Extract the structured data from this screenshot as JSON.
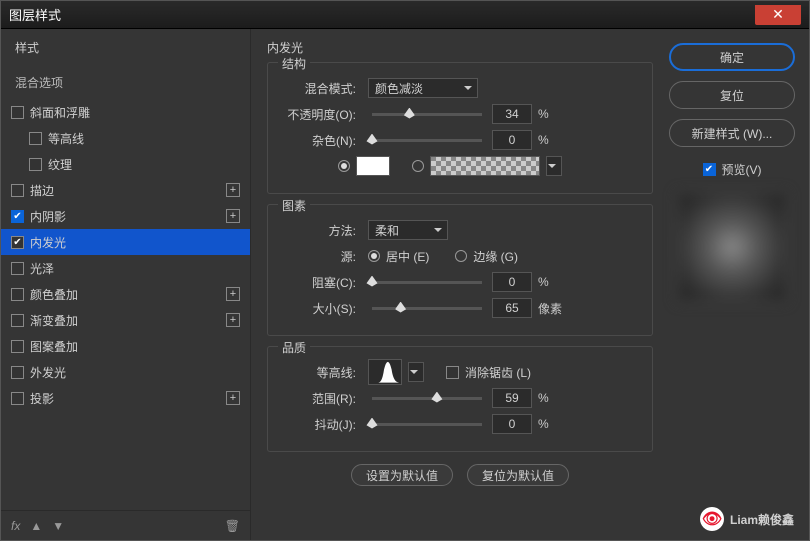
{
  "window": {
    "title": "图层样式"
  },
  "sidebar": {
    "styles_label": "样式",
    "blending_label": "混合选项",
    "items": [
      {
        "label": "斜面和浮雕",
        "checked": false,
        "hasFx": false,
        "indent": false
      },
      {
        "label": "等高线",
        "checked": false,
        "hasFx": false,
        "indent": true
      },
      {
        "label": "纹理",
        "checked": false,
        "hasFx": false,
        "indent": true
      },
      {
        "label": "描边",
        "checked": false,
        "hasFx": true,
        "indent": false
      },
      {
        "label": "内阴影",
        "checked": true,
        "hasFx": true,
        "indent": false
      },
      {
        "label": "内发光",
        "checked": true,
        "hasFx": false,
        "indent": false,
        "selected": true
      },
      {
        "label": "光泽",
        "checked": false,
        "hasFx": false,
        "indent": false
      },
      {
        "label": "颜色叠加",
        "checked": false,
        "hasFx": true,
        "indent": false
      },
      {
        "label": "渐变叠加",
        "checked": false,
        "hasFx": true,
        "indent": false
      },
      {
        "label": "图案叠加",
        "checked": false,
        "hasFx": false,
        "indent": false
      },
      {
        "label": "外发光",
        "checked": false,
        "hasFx": false,
        "indent": false
      },
      {
        "label": "投影",
        "checked": false,
        "hasFx": true,
        "indent": false
      }
    ],
    "fx_label": "fx"
  },
  "panel": {
    "title": "内发光",
    "structure": {
      "group_label": "结构",
      "blend_mode_label": "混合模式:",
      "blend_mode_value": "颜色减淡",
      "opacity_label": "不透明度(O):",
      "opacity_value": "34",
      "opacity_unit": "%",
      "noise_label": "杂色(N):",
      "noise_value": "0",
      "noise_unit": "%"
    },
    "elements": {
      "group_label": "图素",
      "technique_label": "方法:",
      "technique_value": "柔和",
      "source_label": "源:",
      "source_center": "居中 (E)",
      "source_edge": "边缘 (G)",
      "choke_label": "阻塞(C):",
      "choke_value": "0",
      "choke_unit": "%",
      "size_label": "大小(S):",
      "size_value": "65",
      "size_unit": "像素"
    },
    "quality": {
      "group_label": "品质",
      "contour_label": "等高线:",
      "antialias_label": "消除锯齿 (L)",
      "range_label": "范围(R):",
      "range_value": "59",
      "range_unit": "%",
      "jitter_label": "抖动(J):",
      "jitter_value": "0",
      "jitter_unit": "%"
    },
    "buttons": {
      "make_default": "设置为默认值",
      "reset_default": "复位为默认值"
    }
  },
  "right": {
    "ok": "确定",
    "cancel": "复位",
    "new_style": "新建样式 (W)...",
    "preview": "预览(V)"
  },
  "watermark": "Liam赖俊鑫"
}
